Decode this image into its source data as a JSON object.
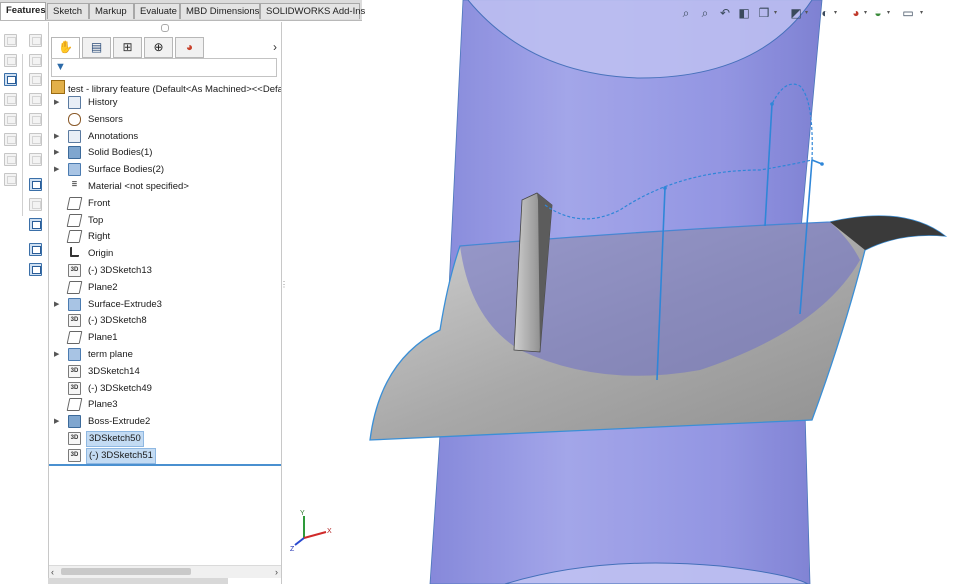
{
  "command_manager": {
    "tabs": [
      "Features",
      "Sketch",
      "Markup",
      "Evaluate",
      "MBD Dimensions",
      "SOLIDWORKS Add-Ins"
    ],
    "active_tab": "Features"
  },
  "feature_manager": {
    "panel_tabs": [
      {
        "icon": "feature-tree-icon"
      },
      {
        "icon": "property-manager-icon"
      },
      {
        "icon": "configuration-manager-icon"
      },
      {
        "icon": "dim-xpert-icon"
      },
      {
        "icon": "display-manager-icon"
      }
    ],
    "expand_arrow": "›",
    "filter_icon": "filter-icon",
    "root_label": "test - library feature  (Default<As Machined><<Defa",
    "items": [
      {
        "label": "History",
        "icon": "history-folder-icon",
        "expandable": true,
        "selected": false
      },
      {
        "label": "Sensors",
        "icon": "sensors-icon",
        "expandable": false,
        "selected": false
      },
      {
        "label": "Annotations",
        "icon": "annotations-icon",
        "expandable": true,
        "selected": false
      },
      {
        "label": "Solid Bodies(1)",
        "icon": "solid-bodies-icon",
        "expandable": true,
        "selected": false
      },
      {
        "label": "Surface Bodies(2)",
        "icon": "surface-bodies-icon",
        "expandable": true,
        "selected": false
      },
      {
        "label": "Material <not specified>",
        "icon": "material-icon",
        "expandable": false,
        "selected": false
      },
      {
        "label": "Front",
        "icon": "plane-icon",
        "expandable": false,
        "selected": false
      },
      {
        "label": "Top",
        "icon": "plane-icon",
        "expandable": false,
        "selected": false
      },
      {
        "label": "Right",
        "icon": "plane-icon",
        "expandable": false,
        "selected": false
      },
      {
        "label": "Origin",
        "icon": "origin-icon",
        "expandable": false,
        "selected": false
      },
      {
        "label": "(-) 3DSketch13",
        "icon": "3d-sketch-icon",
        "expandable": false,
        "selected": false
      },
      {
        "label": "Plane2",
        "icon": "plane-icon",
        "expandable": false,
        "selected": false
      },
      {
        "label": "Surface-Extrude3",
        "icon": "surface-extrude-icon",
        "expandable": true,
        "selected": false
      },
      {
        "label": "(-) 3DSketch8",
        "icon": "3d-sketch-icon",
        "expandable": false,
        "selected": false
      },
      {
        "label": "Plane1",
        "icon": "plane-icon",
        "expandable": false,
        "selected": false
      },
      {
        "label": "term plane",
        "icon": "surface-extrude-icon",
        "expandable": true,
        "selected": false
      },
      {
        "label": "3DSketch14",
        "icon": "3d-sketch-icon",
        "expandable": false,
        "selected": false
      },
      {
        "label": "(-) 3DSketch49",
        "icon": "3d-sketch-icon",
        "expandable": false,
        "selected": false
      },
      {
        "label": "Plane3",
        "icon": "plane-icon",
        "expandable": false,
        "selected": false
      },
      {
        "label": "Boss-Extrude2",
        "icon": "boss-extrude-icon",
        "expandable": true,
        "selected": false
      },
      {
        "label": "3DSketch50",
        "icon": "3d-sketch-icon",
        "expandable": false,
        "selected": true
      },
      {
        "label": "(-) 3DSketch51",
        "icon": "3d-sketch-icon",
        "expandable": false,
        "selected": true
      }
    ],
    "sketch_icon_text": "3D"
  },
  "view_toolbar": {
    "icons": [
      "zoom-to-fit-icon",
      "zoom-to-area-icon",
      "previous-view-icon",
      "section-view-icon",
      "view-orientation-icon",
      "display-style-icon",
      "hide-show-items-icon",
      "edit-appearance-icon",
      "apply-scene-icon",
      "view-settings-icon"
    ]
  },
  "triad": {
    "x_label": "X",
    "y_label": "Y",
    "z_label": "Z"
  },
  "colors": {
    "cylinder": "#8c8fe0",
    "surface": "#a6a6a6",
    "edge": "#3b8fd6",
    "selection": "#c3dbf3"
  }
}
